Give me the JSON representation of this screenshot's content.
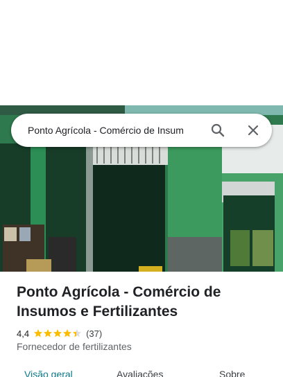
{
  "search": {
    "query": "Ponto Agrícola - Comércio de Insum",
    "search_icon": "search-icon",
    "close_icon": "close-icon"
  },
  "place": {
    "title": "Ponto Agrícola - Comércio de Insumos e Fertilizantes",
    "rating": "4,4",
    "rating_value": 4.4,
    "review_count": "(37)",
    "category": "Fornecedor de fertilizantes"
  },
  "tabs": [
    {
      "label": "Visão geral",
      "active": true
    },
    {
      "label": "Avaliações",
      "active": false
    },
    {
      "label": "Sobre",
      "active": false
    }
  ],
  "colors": {
    "star": "#fbbc04",
    "active_tab": "#0b7a8a",
    "text_primary": "#202124",
    "text_secondary": "#5f6368"
  }
}
